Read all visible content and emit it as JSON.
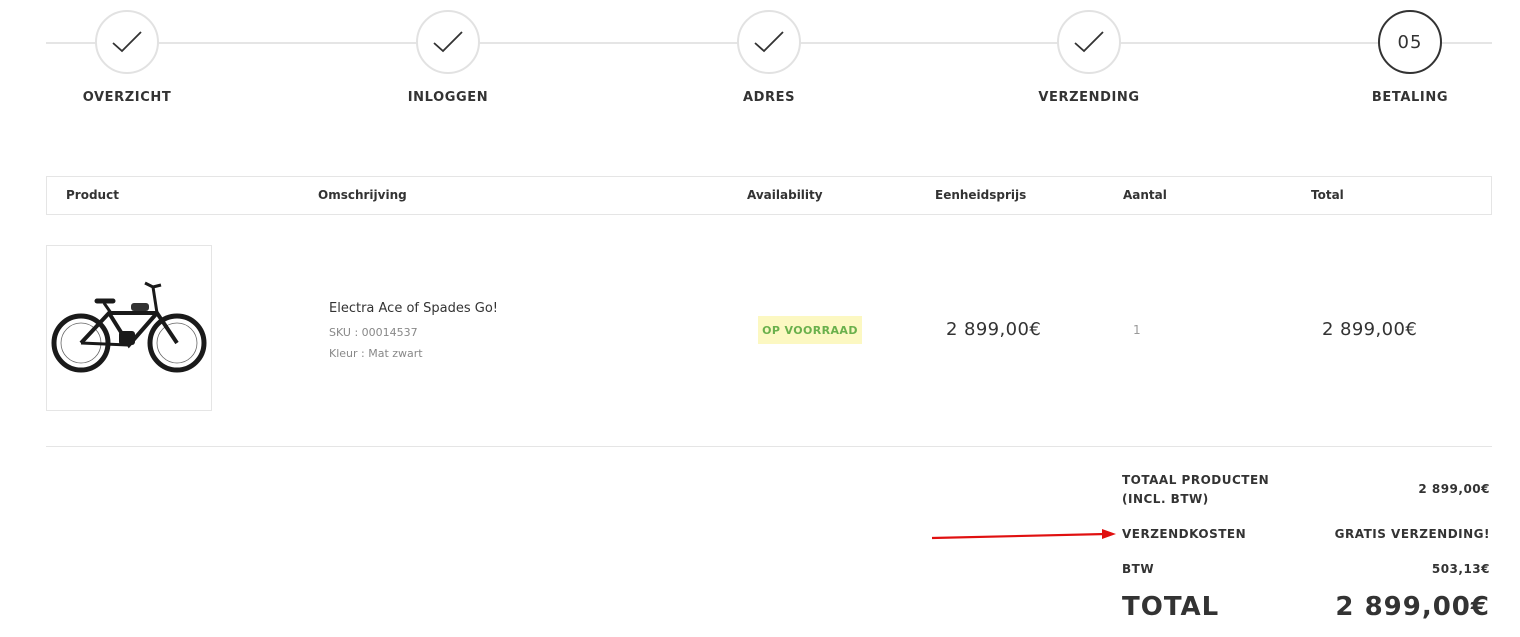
{
  "steps": [
    {
      "label": "OVERZICHT",
      "state": "done",
      "icon": "check-icon"
    },
    {
      "label": "INLOGGEN",
      "state": "done",
      "icon": "check-icon"
    },
    {
      "label": "ADRES",
      "state": "done",
      "icon": "check-icon"
    },
    {
      "label": "VERZENDING",
      "state": "done",
      "icon": "check-icon"
    },
    {
      "label": "BETALING",
      "state": "active",
      "number": "05"
    }
  ],
  "table": {
    "headers": [
      "Product",
      "Omschrijving",
      "Availability",
      "Eenheidsprijs",
      "Aantal",
      "Total"
    ]
  },
  "product": {
    "name": "Electra Ace of Spades Go!",
    "sku": "SKU : 00014537",
    "color": "Kleur : Mat zwart",
    "availability": "OP VOORRAAD",
    "unit_price": "2 899,00€",
    "quantity": "1",
    "total": "2 899,00€",
    "image_icon": "bicycle-icon"
  },
  "totals": {
    "products_label_line1": "TOTAAL PRODUCTEN",
    "products_label_line2": "(INCL. BTW)",
    "products_value": "2 899,00€",
    "shipping_label": "VERZENDKOSTEN",
    "shipping_value": "GRATIS VERZENDING!",
    "vat_label": "BTW",
    "vat_value": "503,13€",
    "grand_label": "TOTAL",
    "grand_value": "2 899,00€"
  },
  "colors": {
    "badge_bg": "#fcf8c2",
    "badge_text": "#6ab04c",
    "annotation_arrow": "#e01010"
  }
}
